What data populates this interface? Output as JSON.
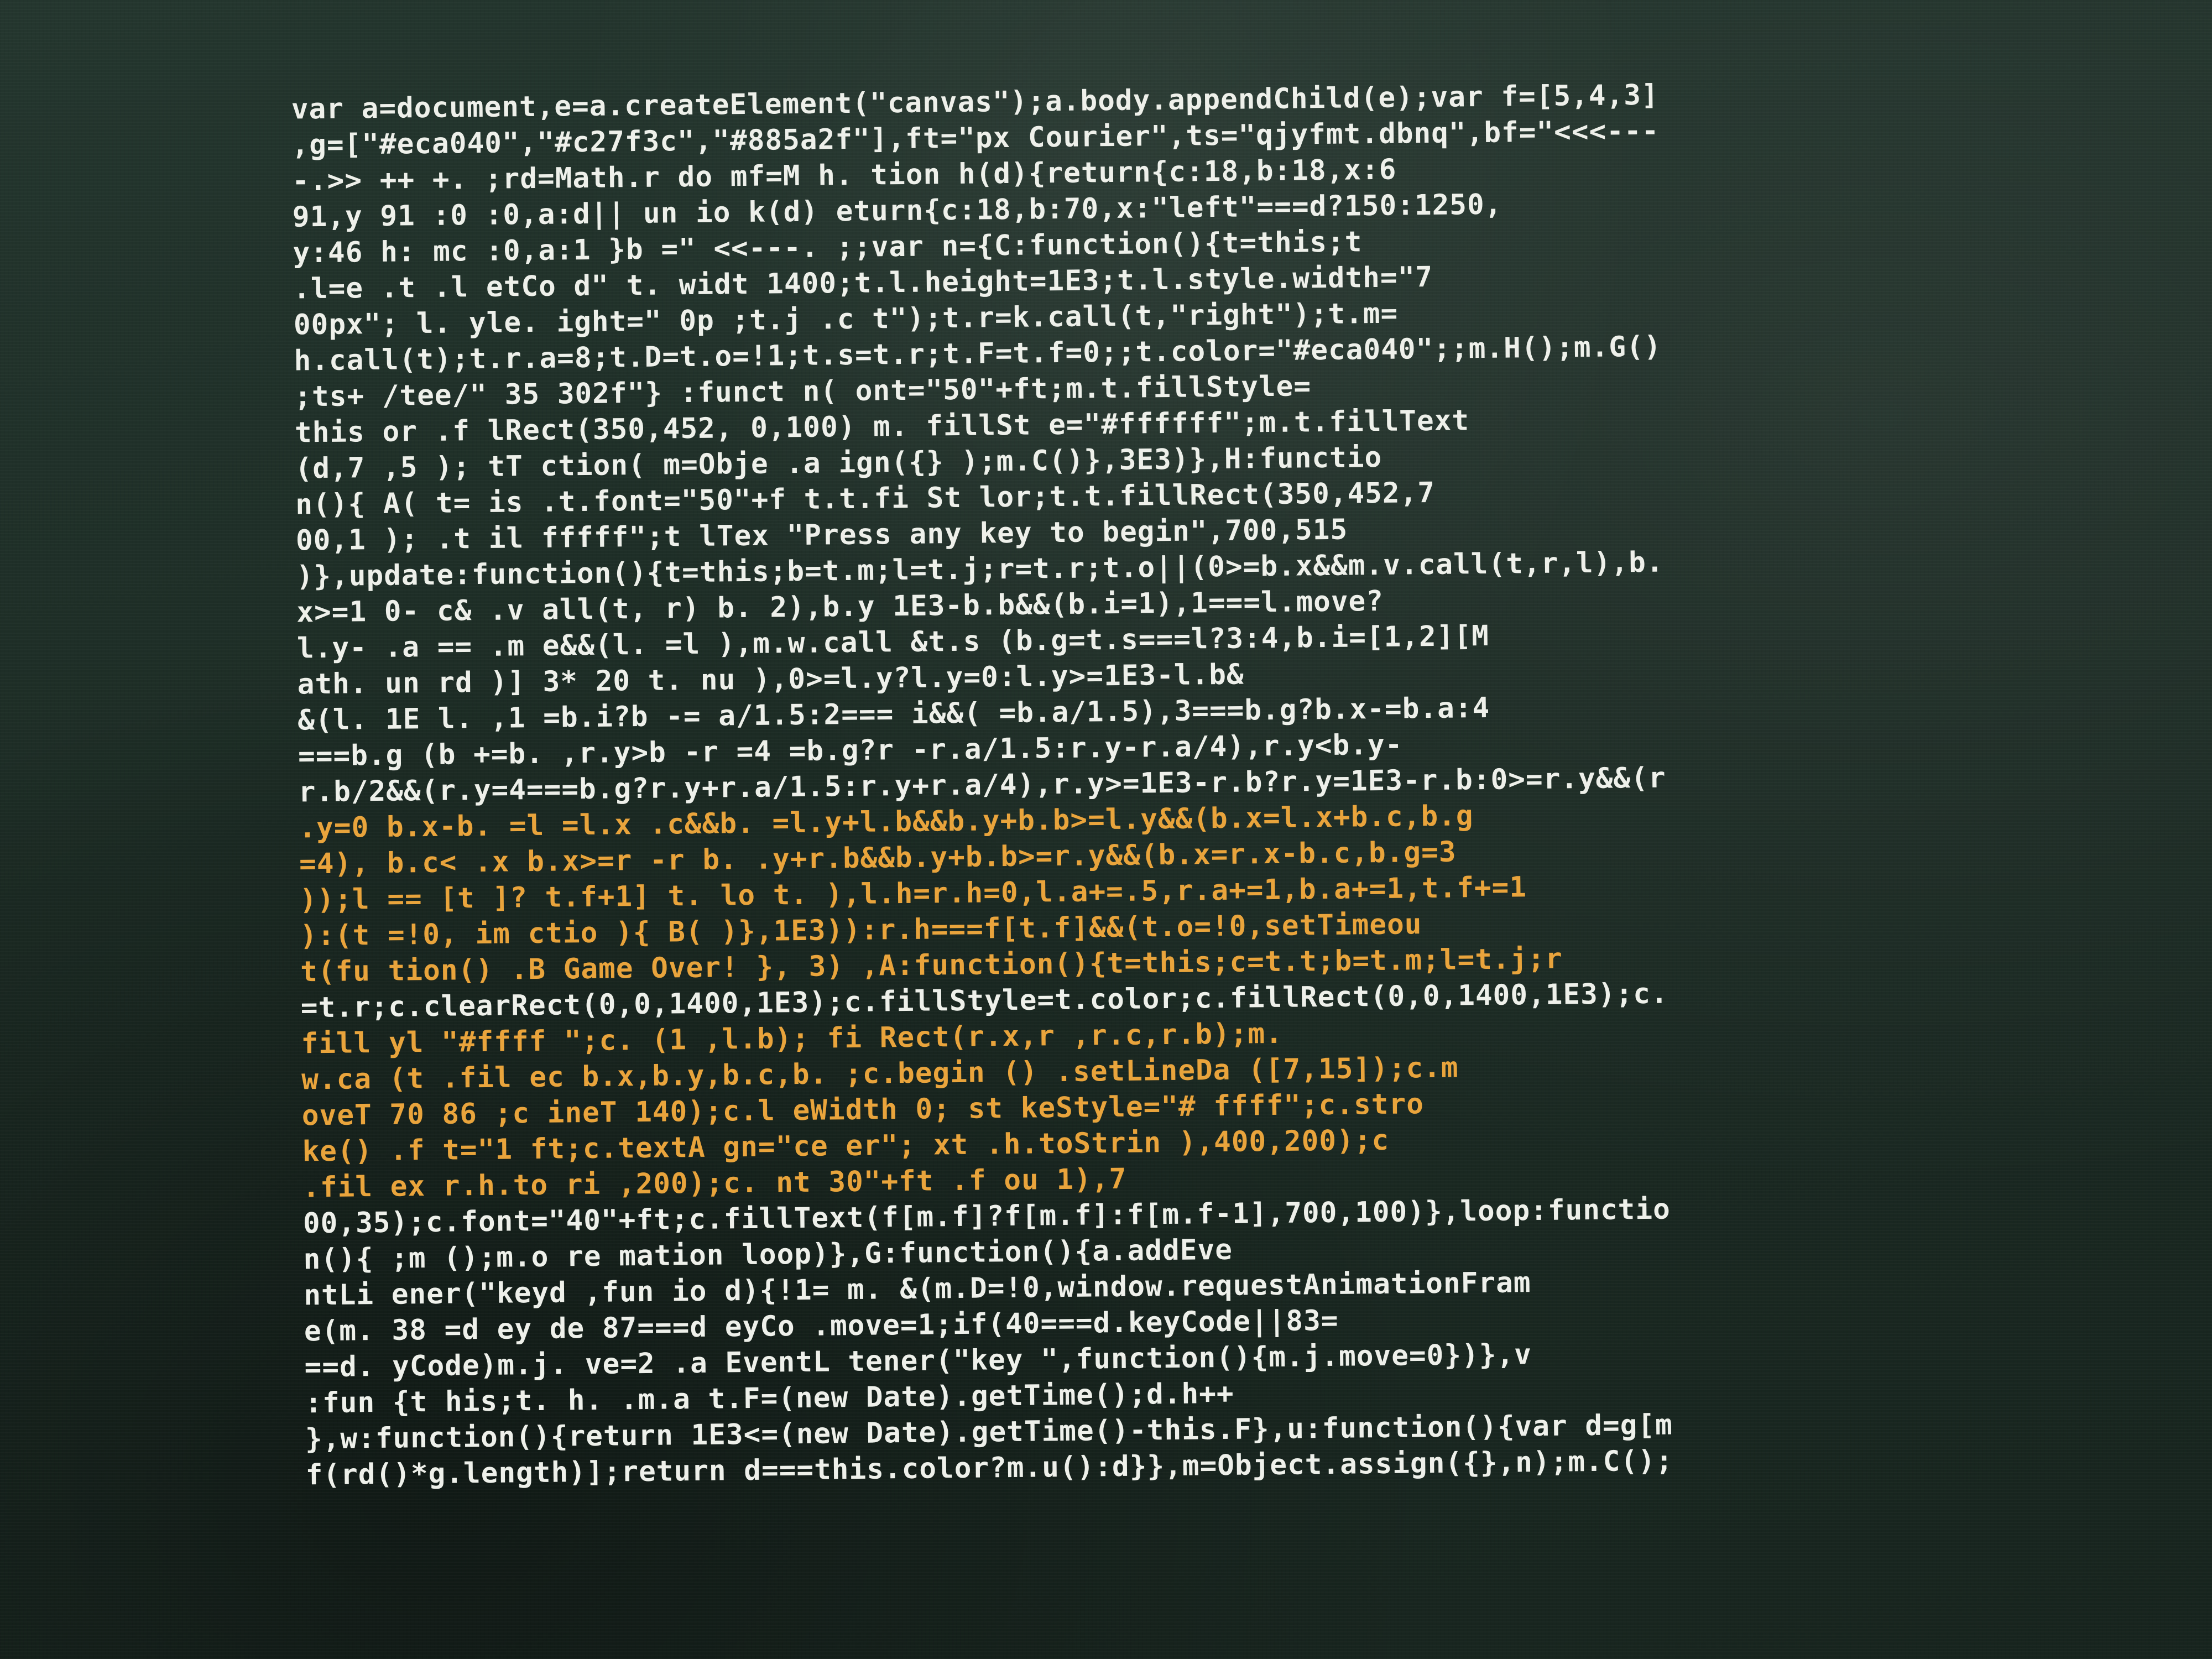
{
  "shirt": {
    "fabric_color": "#1d2d26",
    "ink_color": "#eef0ea",
    "accent_color": "#e9a43c"
  },
  "code_lines": [
    "var a=document,e=a.createElement(\"canvas\");a.body.appendChild(e);var f=[5,4,3]",
    ",g=[\"#eca040\",\"#c27f3c\",\"#885a2f\"],ft=\"px Courier\",ts=\"qjyfmt.dbnq\",bf=\"<<<---",
    "-.>> ++ +. ;rd=Math.r do mf=M h. tion h(d){return{c:18,b:18,x:6",
    "91,y 91 :0 :0,a:d|| un io k(d) eturn{c:18,b:70,x:\"left\"===d?150:1250,",
    "y:46 h: mc :0,a:1 }b =\" <<---. ;;var n={C:function(){t=this;t",
    ".l=e .t .l etCo d\" t. widt 1400;t.l.height=1E3;t.l.style.width=\"7",
    "00px\"; l. yle. ight=\" 0p ;t.j .c t\");t.r=k.call(t,\"right\");t.m=",
    "h.call(t);t.r.a=8;t.D=t.o=!1;t.s=t.r;t.F=t.f=0;;t.color=\"#eca040\";;m.H();m.G()",
    ";ts+ /tee/\" 35 302f\"} :funct n( ont=\"50\"+ft;m.t.fillStyle=",
    "this or .f lRect(350,452, 0,100) m. fillSt e=\"#ffffff\";m.t.fillText",
    "(d,7 ,5 ); tT ction( m=Obje .a ign({} );m.C()},3E3)},H:functio",
    "n(){ A( t= is .t.font=\"50\"+f t.t.fi St lor;t.t.fillRect(350,452,7",
    "00,1 ); .t il fffff\";t lTex \"Press any key to begin\",700,515",
    ")},update:function(){t=this;b=t.m;l=t.j;r=t.r;t.o||(0>=b.x&&m.v.call(t,r,l),b.",
    "x>=1 0- c& .v all(t, r) b. 2),b.y 1E3-b.b&&(b.i=1),1===l.move?",
    "l.y- .a == .m e&&(l. =l ),m.w.call &t.s (b.g=t.s===l?3:4,b.i=[1,2][M",
    "ath. un rd )] 3* 20 t. nu ),0>=l.y?l.y=0:l.y>=1E3-l.b&",
    "&(l. 1E l. ,1 =b.i?b -= a/1.5:2=== i&&( =b.a/1.5),3===b.g?b.x-=b.a:4",
    "===b.g (b +=b. ,r.y>b -r =4 =b.g?r -r.a/1.5:r.y-r.a/4),r.y<b.y-",
    "r.b/2&&(r.y=4===b.g?r.y+r.a/1.5:r.y+r.a/4),r.y>=1E3-r.b?r.y=1E3-r.b:0>=r.y&&(r",
    ".y=0 b.x-b. =l =l.x .c&&b. =l.y+l.b&&b.y+b.b>=l.y&&(b.x=l.x+b.c,b.g",
    "=4), b.c< .x b.x>=r -r b. .y+r.b&&b.y+b.b>=r.y&&(b.x=r.x-b.c,b.g=3",
    "));l == [t ]? t.f+1] t. lo t. ),l.h=r.h=0,l.a+=.5,r.a+=1,b.a+=1,t.f+=1",
    "):(t =!0, im ctio ){ B( )},1E3)):r.h===f[t.f]&&(t.o=!0,setTimeou",
    "t(fu tion() .B Game Over! }, 3) ,A:function(){t=this;c=t.t;b=t.m;l=t.j;r",
    "=t.r;c.clearRect(0,0,1400,1E3);c.fillStyle=t.color;c.fillRect(0,0,1400,1E3);c.",
    "fill yl \"#ffff \";c. (1 ,l.b); fi Rect(r.x,r ,r.c,r.b);m.",
    "w.ca (t .fil ec b.x,b.y,b.c,b. ;c.begin () .setLineDa ([7,15]);c.m",
    "oveT 70 86 ;c ineT 140);c.l eWidth 0; st keStyle=\"# ffff\";c.stro",
    "ke() .f t=\"1 ft;c.textA gn=\"ce er\"; xt .h.toStrin ),400,200);c",
    ".fil ex r.h.to ri ,200);c. nt 30\"+ft .f ou 1),7",
    "00,35);c.font=\"40\"+ft;c.fillText(f[m.f]?f[m.f]:f[m.f-1],700,100)},loop:functio",
    "n(){ ;m ();m.o re mation loop)},G:function(){a.addEve",
    "ntLi ener(\"keyd ,fun io d){!1= m. &(m.D=!0,window.requestAnimationFram",
    "e(m. 38 =d ey de 87===d eyCo .move=1;if(40===d.keyCode||83=",
    "==d. yCode)m.j. ve=2 .a EventL tener(\"key \",function(){m.j.move=0})},v",
    ":fun {t his;t. h. .m.a t.F=(new Date).getTime();d.h++",
    "},w:function(){return 1E3<=(new Date).getTime()-this.F},u:function(){var d=g[m",
    "f(rd()*g.length)];return d===this.color?m.u():d}},m=Object.assign({},n);m.C();"
  ]
}
